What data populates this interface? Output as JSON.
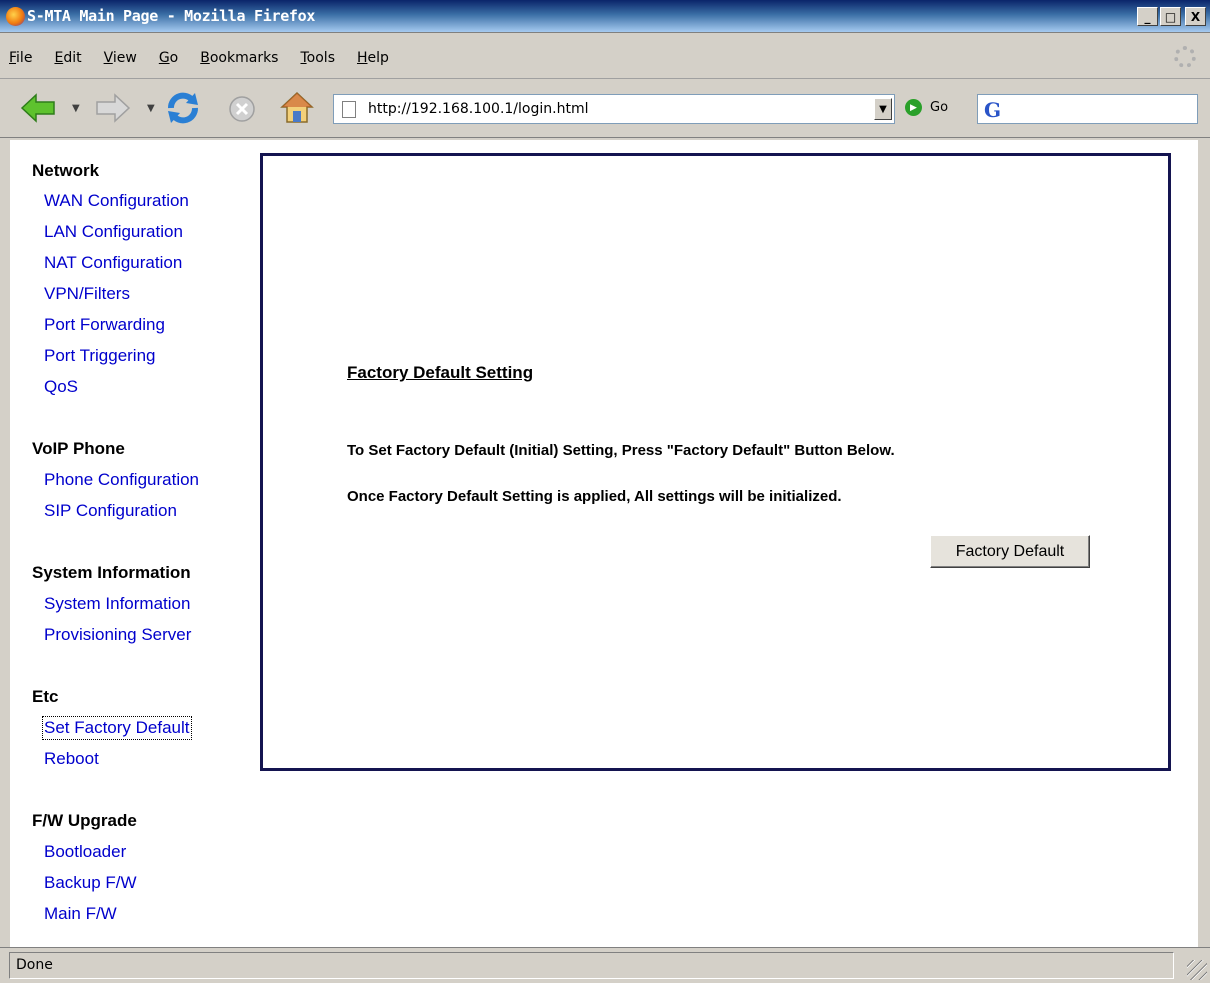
{
  "window": {
    "title": "S-MTA Main Page - Mozilla Firefox",
    "minimize": "_",
    "maximize": "□",
    "close": "X"
  },
  "menu": [
    "File",
    "Edit",
    "View",
    "Go",
    "Bookmarks",
    "Tools",
    "Help"
  ],
  "toolbar": {
    "url": "http://192.168.100.1/login.html",
    "go_label": "Go",
    "icons": [
      "back-icon",
      "forward-icon",
      "reload-icon",
      "stop-icon",
      "home-icon"
    ]
  },
  "sidebar": {
    "sections": [
      {
        "title": "Network",
        "links": [
          "WAN Configuration",
          "LAN Configuration",
          "NAT Configuration",
          "VPN/Filters",
          "Port Forwarding",
          "Port Triggering",
          "QoS"
        ]
      },
      {
        "title": "VoIP Phone",
        "links": [
          "Phone Configuration",
          "SIP Configuration"
        ]
      },
      {
        "title": "System Information",
        "links": [
          "System Information",
          "Provisioning Server"
        ]
      },
      {
        "title": "Etc",
        "links": [
          "Set Factory Default",
          "Reboot"
        ]
      },
      {
        "title": "F/W Upgrade",
        "links": [
          "Bootloader",
          "Backup F/W",
          "Main F/W"
        ]
      }
    ]
  },
  "main": {
    "heading": "Factory Default Setting",
    "line1": "To Set Factory Default (Initial) Setting, Press \"Factory Default\" Button Below.",
    "line2": "Once Factory Default Setting is applied, All settings will be initialized.",
    "button_label": "Factory Default"
  },
  "status": {
    "text": "Done"
  },
  "colors": {
    "link": "#0000cc",
    "panel_border": "#141450"
  }
}
